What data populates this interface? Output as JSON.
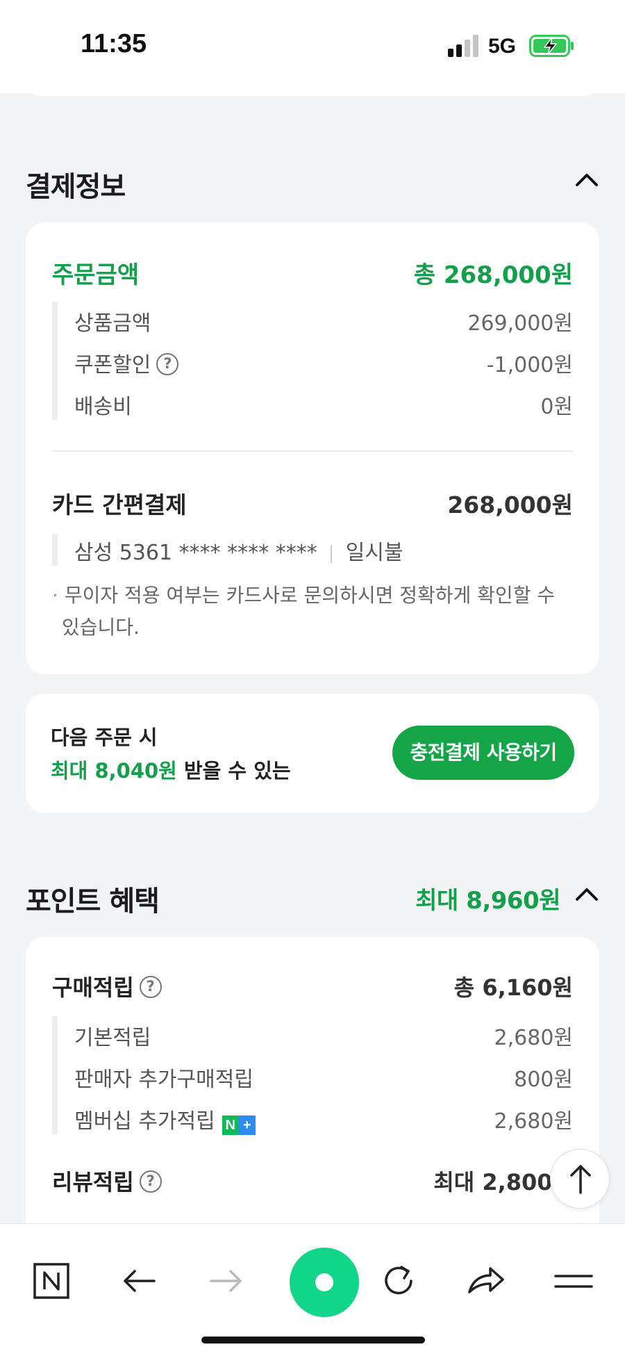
{
  "status_bar": {
    "time": "11:35",
    "network": "5G",
    "battery_color": "#34c759"
  },
  "payment_info": {
    "title": "결제정보",
    "order_amount": {
      "label": "주문금액",
      "total": "총 268,000원",
      "items": [
        {
          "label": "상품금액",
          "value": "269,000원"
        },
        {
          "label": "쿠폰할인",
          "value": "-1,000원",
          "help": "?"
        },
        {
          "label": "배송비",
          "value": "0원"
        }
      ]
    },
    "card_payment": {
      "label": "카드 간편결제",
      "amount": "268,000원",
      "card": "삼성 5361 **** **** ****",
      "installment": "일시불",
      "note_line1": "무이자 적용 여부는 카드사로 문의하시면 정확하게 확인할 수",
      "note_line2": "있습니다."
    }
  },
  "promo": {
    "line1": "다음 주문 시",
    "highlight": "최대 8,040원",
    "line2_rest": " 받을 수 있는",
    "button_label": "충전결제 사용하기"
  },
  "points": {
    "title": "포인트 혜택",
    "max": "최대 8,960원",
    "purchase": {
      "label": "구매적립",
      "total": "총 6,160원",
      "items": [
        {
          "label": "기본적립",
          "value": "2,680원"
        },
        {
          "label": "판매자 추가구매적립",
          "value": "800원"
        },
        {
          "label": "멤버십 추가적립",
          "value": "2,680원",
          "badge": "N+"
        }
      ]
    },
    "review": {
      "label": "리뷰적립",
      "value": "최대 2,800원"
    }
  },
  "colors": {
    "accent_green": "#14a04b",
    "button_green": "#15a447",
    "page_bg": "#f3f4f6"
  },
  "toolbar": {
    "icons": [
      "naver-home-icon",
      "back-arrow-icon",
      "forward-arrow-icon",
      "green-dot-icon",
      "refresh-icon",
      "share-icon",
      "menu-icon"
    ]
  }
}
